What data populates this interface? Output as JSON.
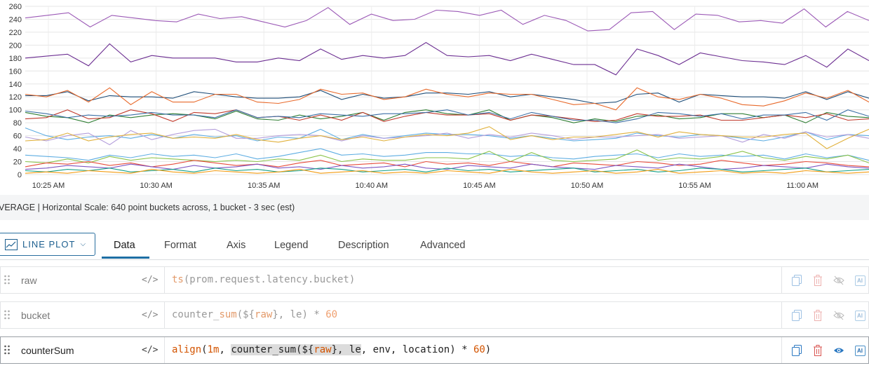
{
  "chart_data": {
    "type": "line",
    "x_tick_labels": [
      "10:25 AM",
      "10:30 AM",
      "10:35 AM",
      "10:40 AM",
      "10:45 AM",
      "10:50 AM",
      "10:55 AM",
      "11:00 AM"
    ],
    "y_tick_labels": [
      "0",
      "20",
      "40",
      "60",
      "80",
      "100",
      "120",
      "140",
      "160",
      "180",
      "200",
      "220",
      "240",
      "260"
    ],
    "ylim": [
      0,
      260
    ],
    "grid": true,
    "series": [
      {
        "color": "#9b59b6",
        "values": [
          242,
          246,
          250,
          228,
          246,
          242,
          238,
          236,
          248,
          241,
          244,
          236,
          228,
          238,
          258,
          232,
          248,
          238,
          240,
          254,
          252,
          246,
          254,
          232,
          246,
          238,
          222,
          224,
          250,
          252,
          224,
          248,
          246,
          236,
          238,
          234,
          256,
          228,
          252,
          238
        ]
      },
      {
        "color": "#6b2d91",
        "values": [
          180,
          183,
          186,
          168,
          202,
          174,
          184,
          180,
          180,
          180,
          174,
          174,
          180,
          176,
          194,
          178,
          184,
          180,
          184,
          204,
          184,
          182,
          184,
          176,
          186,
          178,
          170,
          170,
          154,
          194,
          184,
          170,
          188,
          182,
          176,
          174,
          170,
          184,
          166,
          194,
          176
        ]
      },
      {
        "color": "#1f4e79",
        "values": [
          122,
          122,
          128,
          114,
          122,
          120,
          120,
          118,
          128,
          124,
          120,
          118,
          118,
          120,
          130,
          116,
          124,
          118,
          120,
          126,
          126,
          124,
          128,
          120,
          124,
          120,
          116,
          110,
          112,
          124,
          126,
          112,
          124,
          122,
          120,
          120,
          118,
          128,
          116,
          128,
          118
        ]
      },
      {
        "color": "#e8692a",
        "values": [
          124,
          120,
          130,
          112,
          134,
          108,
          128,
          112,
          112,
          124,
          124,
          112,
          110,
          116,
          132,
          124,
          126,
          116,
          120,
          132,
          124,
          120,
          126,
          124,
          124,
          116,
          108,
          110,
          100,
          134,
          120,
          116,
          124,
          118,
          108,
          106,
          114,
          126,
          118,
          130,
          112
        ]
      },
      {
        "color": "#2e7d32",
        "values": [
          96,
          90,
          88,
          80,
          92,
          88,
          92,
          94,
          92,
          86,
          98,
          86,
          84,
          92,
          86,
          90,
          96,
          84,
          96,
          100,
          94,
          92,
          100,
          84,
          92,
          88,
          80,
          86,
          82,
          90,
          92,
          86,
          88,
          94,
          94,
          88,
          92,
          80,
          96,
          90,
          88
        ]
      },
      {
        "color": "#c0392b",
        "values": [
          86,
          88,
          100,
          86,
          88,
          100,
          94,
          82,
          96,
          94,
          100,
          88,
          90,
          84,
          92,
          84,
          96,
          82,
          90,
          96,
          92,
          92,
          94,
          84,
          92,
          90,
          86,
          82,
          84,
          94,
          90,
          90,
          92,
          84,
          84,
          88,
          92,
          88,
          94,
          84,
          86
        ]
      },
      {
        "color": "#3a6ea5",
        "values": [
          98,
          94,
          88,
          92,
          90,
          92,
          96,
          92,
          92,
          88,
          100,
          88,
          90,
          88,
          94,
          92,
          90,
          94,
          94,
          96,
          100,
          92,
          96,
          86,
          96,
          90,
          84,
          84,
          80,
          86,
          96,
          94,
          90,
          94,
          86,
          92,
          92,
          96,
          84,
          100,
          90
        ]
      },
      {
        "color": "#5dade2",
        "values": [
          72,
          60,
          54,
          58,
          60,
          56,
          62,
          56,
          62,
          58,
          60,
          52,
          58,
          56,
          70,
          54,
          62,
          56,
          60,
          64,
          62,
          62,
          60,
          56,
          60,
          56,
          52,
          54,
          56,
          64,
          60,
          58,
          62,
          60,
          56,
          52,
          58,
          66,
          54,
          62,
          60
        ]
      },
      {
        "color": "#b39ddb",
        "values": [
          58,
          52,
          60,
          64,
          46,
          68,
          54,
          62,
          68,
          70,
          56,
          56,
          60,
          62,
          60,
          52,
          60,
          56,
          58,
          60,
          64,
          56,
          62,
          58,
          64,
          60,
          54,
          58,
          58,
          60,
          62,
          56,
          58,
          60,
          50,
          62,
          56,
          66,
          58,
          62,
          56
        ]
      },
      {
        "color": "#e0b03a",
        "values": [
          52,
          54,
          64,
          52,
          58,
          62,
          64,
          56,
          58,
          56,
          62,
          54,
          50,
          56,
          60,
          54,
          58,
          52,
          58,
          62,
          60,
          64,
          74,
          54,
          60,
          54,
          58,
          58,
          62,
          66,
          58,
          66,
          62,
          60,
          58,
          58,
          62,
          64,
          40,
          56,
          70
        ]
      },
      {
        "color": "#5dade2",
        "values": [
          30,
          28,
          26,
          22,
          30,
          26,
          32,
          28,
          30,
          26,
          32,
          24,
          28,
          34,
          40,
          30,
          32,
          28,
          30,
          34,
          34,
          32,
          32,
          28,
          30,
          26,
          24,
          28,
          30,
          32,
          26,
          32,
          28,
          30,
          28,
          30,
          24,
          32,
          26,
          30,
          22
        ]
      },
      {
        "color": "#8bc34a",
        "values": [
          20,
          18,
          24,
          18,
          28,
          22,
          26,
          24,
          22,
          20,
          22,
          20,
          24,
          22,
          30,
          20,
          24,
          22,
          22,
          26,
          26,
          24,
          36,
          20,
          34,
          22,
          20,
          22,
          24,
          38,
          22,
          26,
          24,
          28,
          36,
          26,
          22,
          28,
          24,
          30,
          18
        ]
      },
      {
        "color": "#e74c3c",
        "values": [
          12,
          18,
          16,
          20,
          14,
          18,
          12,
          16,
          22,
          18,
          14,
          16,
          12,
          18,
          22,
          14,
          16,
          18,
          12,
          20,
          16,
          18,
          14,
          20,
          16,
          12,
          18,
          16,
          14,
          20,
          18,
          14,
          16,
          22,
          18,
          14,
          16,
          20,
          18,
          14,
          12
        ]
      },
      {
        "color": "#7e57c2",
        "values": [
          8,
          10,
          14,
          12,
          10,
          16,
          12,
          8,
          14,
          10,
          12,
          16,
          10,
          12,
          8,
          14,
          10,
          12,
          16,
          10,
          8,
          14,
          12,
          10,
          16,
          12,
          10,
          8,
          14,
          12,
          10,
          16,
          12,
          8,
          10,
          14,
          12,
          10,
          16,
          12,
          10
        ]
      },
      {
        "color": "#16a085",
        "values": [
          6,
          4,
          8,
          6,
          10,
          4,
          6,
          8,
          4,
          10,
          6,
          8,
          4,
          6,
          10,
          8,
          4,
          6,
          8,
          4,
          10,
          6,
          8,
          4,
          6,
          8,
          10,
          4,
          6,
          8,
          4,
          6,
          10,
          8,
          4,
          6,
          8,
          10,
          4,
          6,
          8
        ]
      },
      {
        "color": "#f39c12",
        "values": [
          2,
          4,
          2,
          6,
          4,
          2,
          8,
          4,
          2,
          6,
          4,
          2,
          4,
          8,
          2,
          4,
          6,
          2,
          4,
          2,
          6,
          4,
          2,
          8,
          4,
          2,
          4,
          6,
          2,
          4,
          8,
          2,
          4,
          6,
          2,
          4,
          2,
          6,
          4,
          2,
          4
        ]
      }
    ]
  },
  "info_bar": {
    "text": "VERAGE  |  Horizontal Scale: 640 point buckets across, 1 bucket - 3 sec (est)"
  },
  "toolbar": {
    "plot_type_label": "LINE PLOT",
    "tabs": [
      "Data",
      "Format",
      "Axis",
      "Legend",
      "Description",
      "Advanced"
    ]
  },
  "queries": [
    {
      "name": "raw",
      "code_icon": "</>",
      "expr_parts": [
        {
          "t": "ts",
          "c": "fn"
        },
        {
          "t": "(prom.request.latency.bucket)",
          "c": ""
        }
      ]
    },
    {
      "name": "bucket",
      "code_icon": "</>",
      "expr_parts": [
        {
          "t": "counter_",
          "c": ""
        },
        {
          "t": "sum",
          "c": "fn"
        },
        {
          "t": "(${",
          "c": ""
        },
        {
          "t": "raw",
          "c": "fn"
        },
        {
          "t": "}, le) * ",
          "c": ""
        },
        {
          "t": "60",
          "c": "num"
        }
      ]
    },
    {
      "name": "counterSum",
      "code_icon": "</>",
      "expr_parts": [
        {
          "t": "align",
          "c": "fn"
        },
        {
          "t": "(",
          "c": ""
        },
        {
          "t": "1m",
          "c": "num"
        },
        {
          "t": ", ",
          "c": ""
        },
        {
          "t": "counter_sum(${",
          "c": "hl"
        },
        {
          "t": "raw",
          "c": "hl fn"
        },
        {
          "t": "}, le",
          "c": "hl"
        },
        {
          "t": ", env, location) * ",
          "c": ""
        },
        {
          "t": "60",
          "c": "num"
        },
        {
          "t": ")",
          "c": ""
        }
      ]
    }
  ],
  "icons": {
    "copy": "copy-icon",
    "delete": "trash-icon",
    "visibility": "eye-icon",
    "ai": "ai-icon",
    "grip": "drag-handle-icon"
  },
  "ai_label": "AI"
}
